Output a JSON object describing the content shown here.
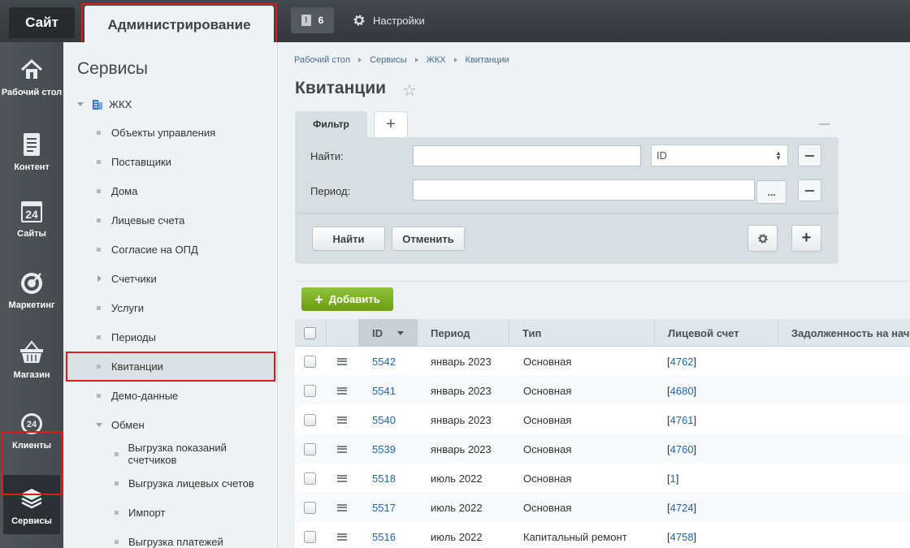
{
  "topbar": {
    "tab_site": "Сайт",
    "tab_admin": "Администрирование",
    "notifications_count": "6",
    "settings_label": "Настройки"
  },
  "iconbar": [
    {
      "label": "Рабочий стол",
      "icon": "home-icon"
    },
    {
      "label": "Контент",
      "icon": "document-icon"
    },
    {
      "label": "Сайты",
      "icon": "calendar-24-icon"
    },
    {
      "label": "Маркетинг",
      "icon": "target-icon"
    },
    {
      "label": "Магазин",
      "icon": "basket-icon"
    },
    {
      "label": "Клиенты",
      "icon": "cloud-24-icon"
    },
    {
      "label": "Сервисы",
      "icon": "layers-icon"
    }
  ],
  "menu": {
    "title": "Сервисы",
    "root": "ЖКХ",
    "items": [
      "Объекты управления",
      "Поставщики",
      "Дома",
      "Лицевые счета",
      "Согласие на ОПД",
      "Счетчики",
      "Услуги",
      "Периоды",
      "Квитанции",
      "Демо-данные",
      "Обмен"
    ],
    "sub_items": [
      "Выгрузка показаний счетчиков",
      "Выгрузка лицевых счетов",
      "Импорт",
      "Выгрузка платежей"
    ]
  },
  "breadcrumb": [
    "Рабочий стол",
    "Сервисы",
    "ЖКХ",
    "Квитанции"
  ],
  "page_title": "Квитанции",
  "filter": {
    "tab_label": "Фильтр",
    "find_label": "Найти:",
    "find_value": "",
    "select_value": "ID",
    "period_label": "Период:",
    "period_value": "",
    "dots_label": "...",
    "find_button": "Найти",
    "cancel_button": "Отменить"
  },
  "list": {
    "add_button": "Добавить",
    "columns": [
      "ID",
      "Период",
      "Тип",
      "Лицевой счет",
      "Задолженность на нач"
    ],
    "rows": [
      {
        "id": "5542",
        "period": "январь 2023",
        "type": "Основная",
        "account": "4762"
      },
      {
        "id": "5541",
        "period": "январь 2023",
        "type": "Основная",
        "account": "4680"
      },
      {
        "id": "5540",
        "period": "январь 2023",
        "type": "Основная",
        "account": "4761"
      },
      {
        "id": "5539",
        "period": "январь 2023",
        "type": "Основная",
        "account": "4760"
      },
      {
        "id": "5518",
        "period": "июль 2022",
        "type": "Основная",
        "account": "1"
      },
      {
        "id": "5517",
        "period": "июль 2022",
        "type": "Основная",
        "account": "4724"
      },
      {
        "id": "5516",
        "period": "июль 2022",
        "type": "Капитальный ремонт",
        "account": "4758"
      }
    ]
  },
  "colors": {
    "highlight": "#e01a1a",
    "add_button": "#7cb020",
    "link": "#2067b0"
  }
}
